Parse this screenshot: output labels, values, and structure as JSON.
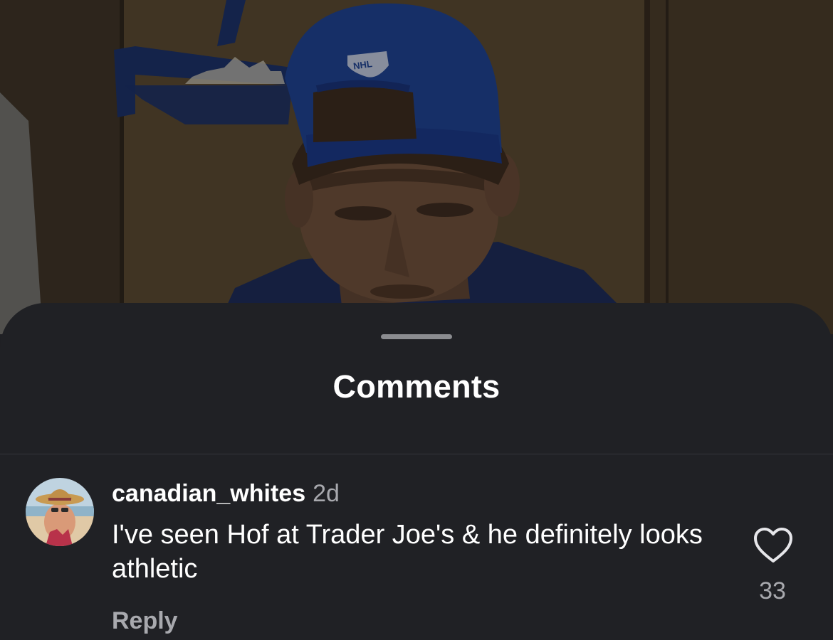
{
  "background": {
    "cap_logo_text": "NHL"
  },
  "sheet": {
    "title": "Comments"
  },
  "comment": {
    "username": "canadian_whites",
    "time": "2d",
    "text": "I've seen Hof at Trader Joe's & he definitely looks athletic",
    "reply_label": "Reply",
    "like_count": "33",
    "like_icon": "heart-outline-icon"
  },
  "colors": {
    "sheet_bg": "#202125",
    "primary_text": "#ffffff",
    "secondary_text": "#a8a9ae"
  }
}
